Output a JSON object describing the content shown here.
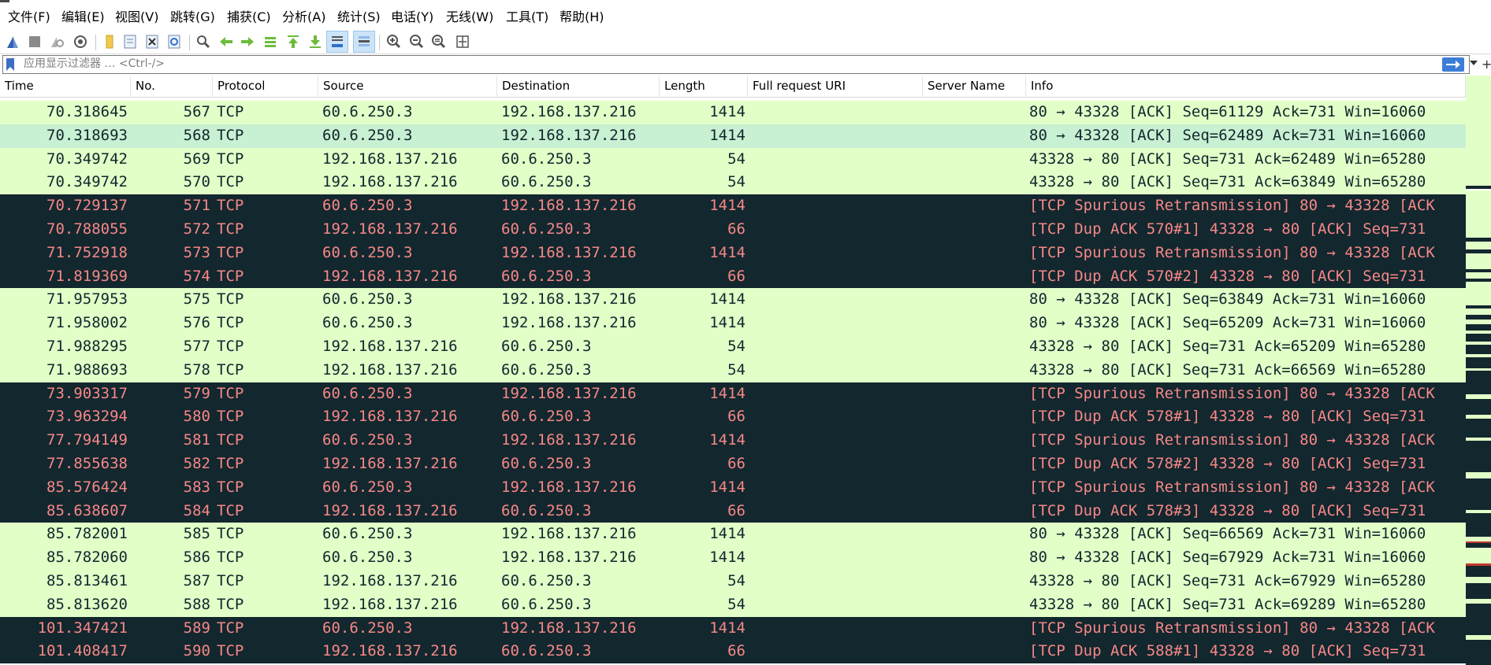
{
  "menu": [
    "文件(F)",
    "编辑(E)",
    "视图(V)",
    "跳转(G)",
    "捕获(C)",
    "分析(A)",
    "统计(S)",
    "电话(Y)",
    "无线(W)",
    "工具(T)",
    "帮助(H)"
  ],
  "toolbar": [
    "start-capture-icon",
    "stop-capture-icon",
    "restart-capture-icon",
    "capture-options-icon",
    "open-file-icon",
    "save-file-icon",
    "close-file-icon",
    "reload-file-icon",
    "find-packet-icon",
    "go-back-icon",
    "go-forward-icon",
    "go-to-packet-icon",
    "go-to-first-packet-icon",
    "go-to-last-packet-icon",
    "auto-scroll-icon",
    "colorize-icon",
    "zoom-in-icon",
    "zoom-out-icon",
    "zoom-normal-icon",
    "resize-columns-icon"
  ],
  "filter": {
    "placeholder": "应用显示过滤器 … <Ctrl-/>",
    "plus": "+"
  },
  "columns": [
    "Time",
    "No.",
    "Protocol",
    "Source",
    "Destination",
    "Length",
    "Full request URI",
    "Server Name",
    "Info"
  ],
  "colors": {
    "good_bg": "#e3ffc8",
    "good_fg": "#12272e",
    "selected_bg": "#c8f0d2",
    "bad_bg": "#12272e",
    "bad_fg": "#f78787"
  },
  "packets": [
    {
      "time": "70.318645",
      "no": "567",
      "protocol": "TCP",
      "source": "60.6.250.3",
      "destination": "192.168.137.216",
      "length": "1414",
      "uri": "",
      "server": "",
      "info": "80 → 43328 [ACK] Seq=61129 Ack=731 Win=16060",
      "style": "good"
    },
    {
      "time": "70.318693",
      "no": "568",
      "protocol": "TCP",
      "source": "60.6.250.3",
      "destination": "192.168.137.216",
      "length": "1414",
      "uri": "",
      "server": "",
      "info": "80 → 43328 [ACK] Seq=62489 Ack=731 Win=16060",
      "style": "sel"
    },
    {
      "time": "70.349742",
      "no": "569",
      "protocol": "TCP",
      "source": "192.168.137.216",
      "destination": "60.6.250.3",
      "length": "54",
      "uri": "",
      "server": "",
      "info": "43328 → 80 [ACK] Seq=731 Ack=62489 Win=65280",
      "style": "good"
    },
    {
      "time": "70.349742",
      "no": "570",
      "protocol": "TCP",
      "source": "192.168.137.216",
      "destination": "60.6.250.3",
      "length": "54",
      "uri": "",
      "server": "",
      "info": "43328 → 80 [ACK] Seq=731 Ack=63849 Win=65280",
      "style": "good"
    },
    {
      "time": "70.729137",
      "no": "571",
      "protocol": "TCP",
      "source": "60.6.250.3",
      "destination": "192.168.137.216",
      "length": "1414",
      "uri": "",
      "server": "",
      "info": "[TCP Spurious Retransmission] 80 → 43328 [ACK",
      "style": "bad"
    },
    {
      "time": "70.788055",
      "no": "572",
      "protocol": "TCP",
      "source": "192.168.137.216",
      "destination": "60.6.250.3",
      "length": "66",
      "uri": "",
      "server": "",
      "info": "[TCP Dup ACK 570#1] 43328 → 80 [ACK] Seq=731",
      "style": "bad"
    },
    {
      "time": "71.752918",
      "no": "573",
      "protocol": "TCP",
      "source": "60.6.250.3",
      "destination": "192.168.137.216",
      "length": "1414",
      "uri": "",
      "server": "",
      "info": "[TCP Spurious Retransmission] 80 → 43328 [ACK",
      "style": "bad"
    },
    {
      "time": "71.819369",
      "no": "574",
      "protocol": "TCP",
      "source": "192.168.137.216",
      "destination": "60.6.250.3",
      "length": "66",
      "uri": "",
      "server": "",
      "info": "[TCP Dup ACK 570#2] 43328 → 80 [ACK] Seq=731",
      "style": "bad"
    },
    {
      "time": "71.957953",
      "no": "575",
      "protocol": "TCP",
      "source": "60.6.250.3",
      "destination": "192.168.137.216",
      "length": "1414",
      "uri": "",
      "server": "",
      "info": "80 → 43328 [ACK] Seq=63849 Ack=731 Win=16060",
      "style": "good"
    },
    {
      "time": "71.958002",
      "no": "576",
      "protocol": "TCP",
      "source": "60.6.250.3",
      "destination": "192.168.137.216",
      "length": "1414",
      "uri": "",
      "server": "",
      "info": "80 → 43328 [ACK] Seq=65209 Ack=731 Win=16060",
      "style": "good"
    },
    {
      "time": "71.988295",
      "no": "577",
      "protocol": "TCP",
      "source": "192.168.137.216",
      "destination": "60.6.250.3",
      "length": "54",
      "uri": "",
      "server": "",
      "info": "43328 → 80 [ACK] Seq=731 Ack=65209 Win=65280",
      "style": "good"
    },
    {
      "time": "71.988693",
      "no": "578",
      "protocol": "TCP",
      "source": "192.168.137.216",
      "destination": "60.6.250.3",
      "length": "54",
      "uri": "",
      "server": "",
      "info": "43328 → 80 [ACK] Seq=731 Ack=66569 Win=65280",
      "style": "good"
    },
    {
      "time": "73.903317",
      "no": "579",
      "protocol": "TCP",
      "source": "60.6.250.3",
      "destination": "192.168.137.216",
      "length": "1414",
      "uri": "",
      "server": "",
      "info": "[TCP Spurious Retransmission] 80 → 43328 [ACK",
      "style": "bad"
    },
    {
      "time": "73.963294",
      "no": "580",
      "protocol": "TCP",
      "source": "192.168.137.216",
      "destination": "60.6.250.3",
      "length": "66",
      "uri": "",
      "server": "",
      "info": "[TCP Dup ACK 578#1] 43328 → 80 [ACK] Seq=731",
      "style": "bad"
    },
    {
      "time": "77.794149",
      "no": "581",
      "protocol": "TCP",
      "source": "60.6.250.3",
      "destination": "192.168.137.216",
      "length": "1414",
      "uri": "",
      "server": "",
      "info": "[TCP Spurious Retransmission] 80 → 43328 [ACK",
      "style": "bad"
    },
    {
      "time": "77.855638",
      "no": "582",
      "protocol": "TCP",
      "source": "192.168.137.216",
      "destination": "60.6.250.3",
      "length": "66",
      "uri": "",
      "server": "",
      "info": "[TCP Dup ACK 578#2] 43328 → 80 [ACK] Seq=731",
      "style": "bad"
    },
    {
      "time": "85.576424",
      "no": "583",
      "protocol": "TCP",
      "source": "60.6.250.3",
      "destination": "192.168.137.216",
      "length": "1414",
      "uri": "",
      "server": "",
      "info": "[TCP Spurious Retransmission] 80 → 43328 [ACK",
      "style": "bad"
    },
    {
      "time": "85.638607",
      "no": "584",
      "protocol": "TCP",
      "source": "192.168.137.216",
      "destination": "60.6.250.3",
      "length": "66",
      "uri": "",
      "server": "",
      "info": "[TCP Dup ACK 578#3] 43328 → 80 [ACK] Seq=731",
      "style": "bad"
    },
    {
      "time": "85.782001",
      "no": "585",
      "protocol": "TCP",
      "source": "60.6.250.3",
      "destination": "192.168.137.216",
      "length": "1414",
      "uri": "",
      "server": "",
      "info": "80 → 43328 [ACK] Seq=66569 Ack=731 Win=16060",
      "style": "good"
    },
    {
      "time": "85.782060",
      "no": "586",
      "protocol": "TCP",
      "source": "60.6.250.3",
      "destination": "192.168.137.216",
      "length": "1414",
      "uri": "",
      "server": "",
      "info": "80 → 43328 [ACK] Seq=67929 Ack=731 Win=16060",
      "style": "good"
    },
    {
      "time": "85.813461",
      "no": "587",
      "protocol": "TCP",
      "source": "192.168.137.216",
      "destination": "60.6.250.3",
      "length": "54",
      "uri": "",
      "server": "",
      "info": "43328 → 80 [ACK] Seq=731 Ack=67929 Win=65280",
      "style": "good"
    },
    {
      "time": "85.813620",
      "no": "588",
      "protocol": "TCP",
      "source": "192.168.137.216",
      "destination": "60.6.250.3",
      "length": "54",
      "uri": "",
      "server": "",
      "info": "43328 → 80 [ACK] Seq=731 Ack=69289 Win=65280",
      "style": "good"
    },
    {
      "time": "101.347421",
      "no": "589",
      "protocol": "TCP",
      "source": "60.6.250.3",
      "destination": "192.168.137.216",
      "length": "1414",
      "uri": "",
      "server": "",
      "info": "[TCP Spurious Retransmission] 80 → 43328 [ACK",
      "style": "bad"
    },
    {
      "time": "101.408417",
      "no": "590",
      "protocol": "TCP",
      "source": "192.168.137.216",
      "destination": "60.6.250.3",
      "length": "66",
      "uri": "",
      "server": "",
      "info": "[TCP Dup ACK 588#1] 43328 → 80 [ACK] Seq=731",
      "style": "bad"
    }
  ]
}
